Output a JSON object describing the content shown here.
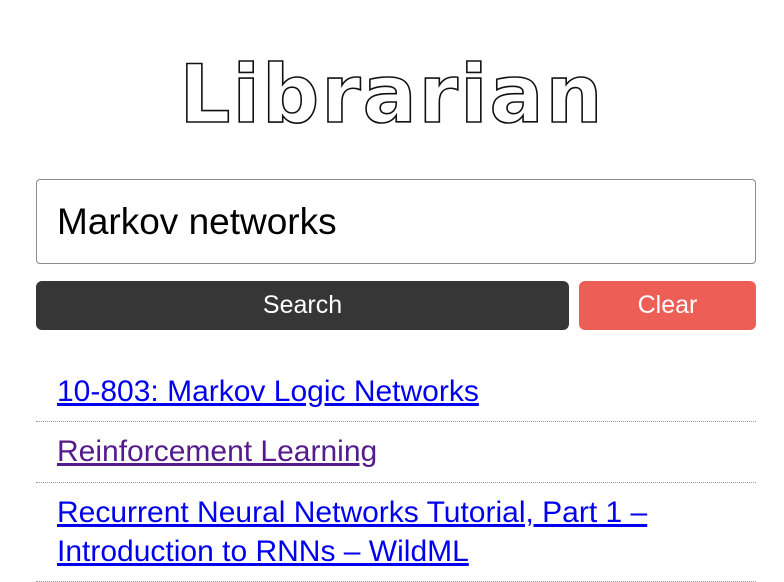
{
  "app": {
    "title": "Librarian"
  },
  "search": {
    "query": "Markov networks"
  },
  "buttons": {
    "search_label": "Search",
    "clear_label": "Clear"
  },
  "results": [
    {
      "title": "10-803: Markov Logic Networks",
      "visited": false
    },
    {
      "title": "Reinforcement Learning",
      "visited": true
    },
    {
      "title": "Recurrent Neural Networks Tutorial, Part 1 – Introduction to RNNs – WildML",
      "visited": false
    }
  ],
  "colors": {
    "search_button": "#363636",
    "clear_button": "#ec5e56",
    "link": "#0000ee",
    "visited_link": "#551a8b"
  }
}
